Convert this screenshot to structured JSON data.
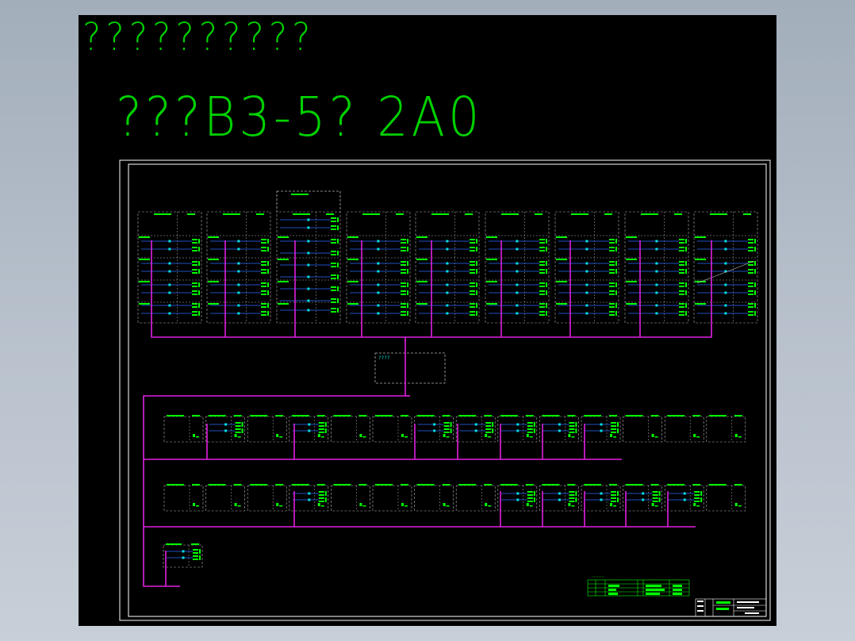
{
  "title": {
    "line1": "??????????",
    "line2": "???B3-5? 2A0"
  },
  "drawing": {
    "controller_label": "????"
  },
  "colors": {
    "background": "#000000",
    "text": "#00d100",
    "frame": "#ffffff",
    "bus": "#e020e0",
    "dashed": "#b0b0b0",
    "devices": "#00ff00",
    "links": "#2a6bff"
  }
}
